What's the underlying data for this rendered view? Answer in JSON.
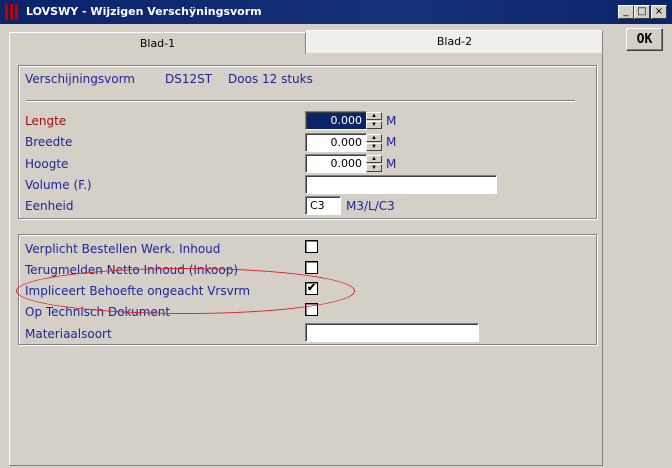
{
  "window": {
    "title": "LOVSWY - Wijzigen Verschÿningsvorm",
    "minimize_glyph": "_",
    "maximize_glyph": "□",
    "close_glyph": "×"
  },
  "tabs": [
    {
      "label": "Blad-1",
      "active": false
    },
    {
      "label": "Blad-2",
      "active": true
    }
  ],
  "ok_button": {
    "label": "OK"
  },
  "header_row": {
    "label": "Verschijningsvorm",
    "code": "DS12ST",
    "description": "Doos 12 stuks"
  },
  "dimensions": {
    "length": {
      "label": "Lengte",
      "value": "0.000",
      "unit": "M"
    },
    "width": {
      "label": "Breedte",
      "value": "0.000",
      "unit": "M"
    },
    "height": {
      "label": "Hoogte",
      "value": "0.000",
      "unit": "M"
    },
    "volume": {
      "label": "Volume (F.)",
      "value": ""
    },
    "unit": {
      "label": "Eenheid",
      "value": "C3",
      "hint": "M3/L/C3"
    }
  },
  "options": [
    {
      "label": "Verplicht Bestellen Werk. Inhoud",
      "checked": false
    },
    {
      "label": "Terugmelden Netto Inhoud (Inkoop)",
      "checked": false
    },
    {
      "label": "Impliceert Behoefte ongeacht Vrsvrm",
      "checked": true
    },
    {
      "label": "Op Technisch Dokument",
      "checked": false
    }
  ],
  "material": {
    "label": "Materiaalsoort",
    "value": ""
  },
  "colors": {
    "title_bar": "#0a246a",
    "label_text": "#1c2799",
    "focused_label": "#a01010",
    "annotation_ellipse": "#e02020"
  },
  "glyphs": {
    "spin_up": "▲",
    "spin_down": "▼",
    "check": "✔"
  }
}
